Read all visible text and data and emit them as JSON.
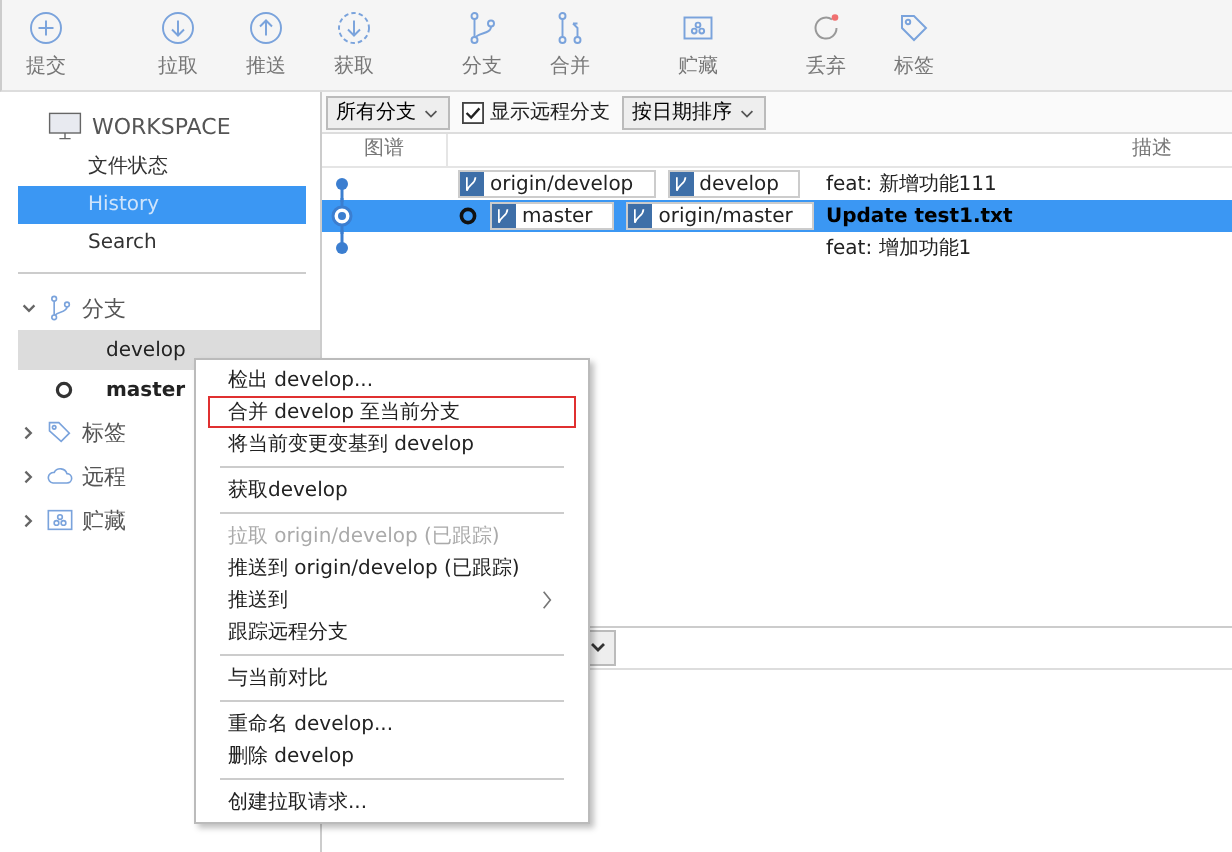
{
  "toolbar": [
    [
      {
        "kind": "commit",
        "label": "提交"
      }
    ],
    [
      {
        "kind": "pull",
        "label": "拉取"
      },
      {
        "kind": "push",
        "label": "推送"
      },
      {
        "kind": "fetch",
        "label": "获取"
      }
    ],
    [
      {
        "kind": "branch",
        "label": "分支"
      },
      {
        "kind": "merge",
        "label": "合并"
      }
    ],
    [
      {
        "kind": "stash",
        "label": "贮藏"
      }
    ],
    [
      {
        "kind": "discard",
        "label": "丢弃"
      },
      {
        "kind": "tag",
        "label": "标签"
      }
    ]
  ],
  "sidebar": {
    "workspace": {
      "title": "WORKSPACE",
      "items": [
        {
          "label": "文件状态",
          "selected": false
        },
        {
          "label": "History",
          "selected": true
        },
        {
          "label": "Search",
          "selected": false
        }
      ]
    },
    "sections": [
      {
        "kind": "branch",
        "label": "分支",
        "expanded": true,
        "children": [
          {
            "label": "develop",
            "selected": true,
            "current": false
          },
          {
            "label": "master",
            "selected": false,
            "current": true
          }
        ]
      },
      {
        "kind": "tag",
        "label": "标签",
        "expanded": false
      },
      {
        "kind": "cloud",
        "label": "远程",
        "expanded": false
      },
      {
        "kind": "stash",
        "label": "贮藏",
        "expanded": false
      }
    ]
  },
  "filter_bar": {
    "branches": "所有分支",
    "show_remote": {
      "label": "显示远程分支",
      "checked": true
    },
    "sort": "按日期排序"
  },
  "history": {
    "columns": [
      "图谱",
      "描述"
    ],
    "rows": [
      {
        "head": false,
        "selected": false,
        "refs": [
          "origin/develop",
          "develop"
        ],
        "message": "feat: 新增功能111"
      },
      {
        "head": true,
        "selected": true,
        "refs": [
          "master",
          "origin/master"
        ],
        "message": "Update test1.txt"
      },
      {
        "head": false,
        "selected": false,
        "refs": [],
        "message": "feat:  增加功能1"
      }
    ]
  },
  "context_menu": [
    {
      "kind": "item",
      "label": "检出 develop...",
      "disabled": false,
      "highlighted": false,
      "submenu": false
    },
    {
      "kind": "item",
      "label": "合并 develop 至当前分支",
      "disabled": false,
      "highlighted": true,
      "submenu": false
    },
    {
      "kind": "item",
      "label": "将当前变更变基到 develop",
      "disabled": false,
      "highlighted": false,
      "submenu": false
    },
    {
      "kind": "separator"
    },
    {
      "kind": "item",
      "label": "获取develop",
      "disabled": false,
      "highlighted": false,
      "submenu": false
    },
    {
      "kind": "separator"
    },
    {
      "kind": "item",
      "label": "拉取 origin/develop (已跟踪)",
      "disabled": true,
      "highlighted": false,
      "submenu": false
    },
    {
      "kind": "item",
      "label": "推送到 origin/develop (已跟踪)",
      "disabled": false,
      "highlighted": false,
      "submenu": false
    },
    {
      "kind": "item",
      "label": "推送到",
      "disabled": false,
      "highlighted": false,
      "submenu": true
    },
    {
      "kind": "item",
      "label": "跟踪远程分支",
      "disabled": false,
      "highlighted": false,
      "submenu": false
    },
    {
      "kind": "separator"
    },
    {
      "kind": "item",
      "label": "与当前对比",
      "disabled": false,
      "highlighted": false,
      "submenu": false
    },
    {
      "kind": "separator"
    },
    {
      "kind": "item",
      "label": "重命名 develop...",
      "disabled": false,
      "highlighted": false,
      "submenu": false
    },
    {
      "kind": "item",
      "label": "删除 develop",
      "disabled": false,
      "highlighted": false,
      "submenu": false
    },
    {
      "kind": "separator"
    },
    {
      "kind": "item",
      "label": "创建拉取请求...",
      "disabled": false,
      "highlighted": false,
      "submenu": false
    }
  ]
}
